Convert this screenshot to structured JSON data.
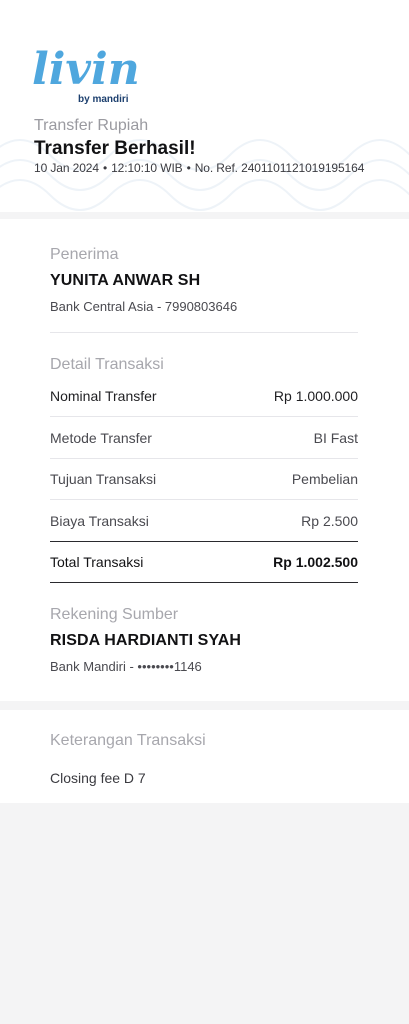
{
  "brand": {
    "logo_text": "livin'",
    "logo_sub": "by mandiri",
    "logo_color": "#4fa7de",
    "accent_color": "#f3b71b"
  },
  "header": {
    "subtitle": "Transfer Rupiah",
    "title": "Transfer Berhasil!",
    "date": "10 Jan 2024",
    "time": "12:10:10 WIB",
    "ref": "No. Ref. 2401101121019195164"
  },
  "recipient": {
    "section_title": "Penerima",
    "name": "YUNITA ANWAR SH",
    "bank_info": "Bank Central Asia - 7990803646"
  },
  "details": {
    "section_title": "Detail Transaksi",
    "rows": [
      {
        "label": "Nominal Transfer",
        "value": "Rp 1.000.000"
      },
      {
        "label": "Metode Transfer",
        "value": "BI Fast"
      },
      {
        "label": "Tujuan Transaksi",
        "value": "Pembelian"
      },
      {
        "label": "Biaya Transaksi",
        "value": "Rp 2.500"
      }
    ],
    "total": {
      "label": "Total Transaksi",
      "value": "Rp 1.002.500"
    }
  },
  "source": {
    "section_title": "Rekening Sumber",
    "name": "RISDA HARDIANTI SYAH",
    "bank_info": "Bank Mandiri - ••••••••1146"
  },
  "notes": {
    "section_title": "Keterangan Transaksi",
    "text": "Closing fee D 7"
  }
}
